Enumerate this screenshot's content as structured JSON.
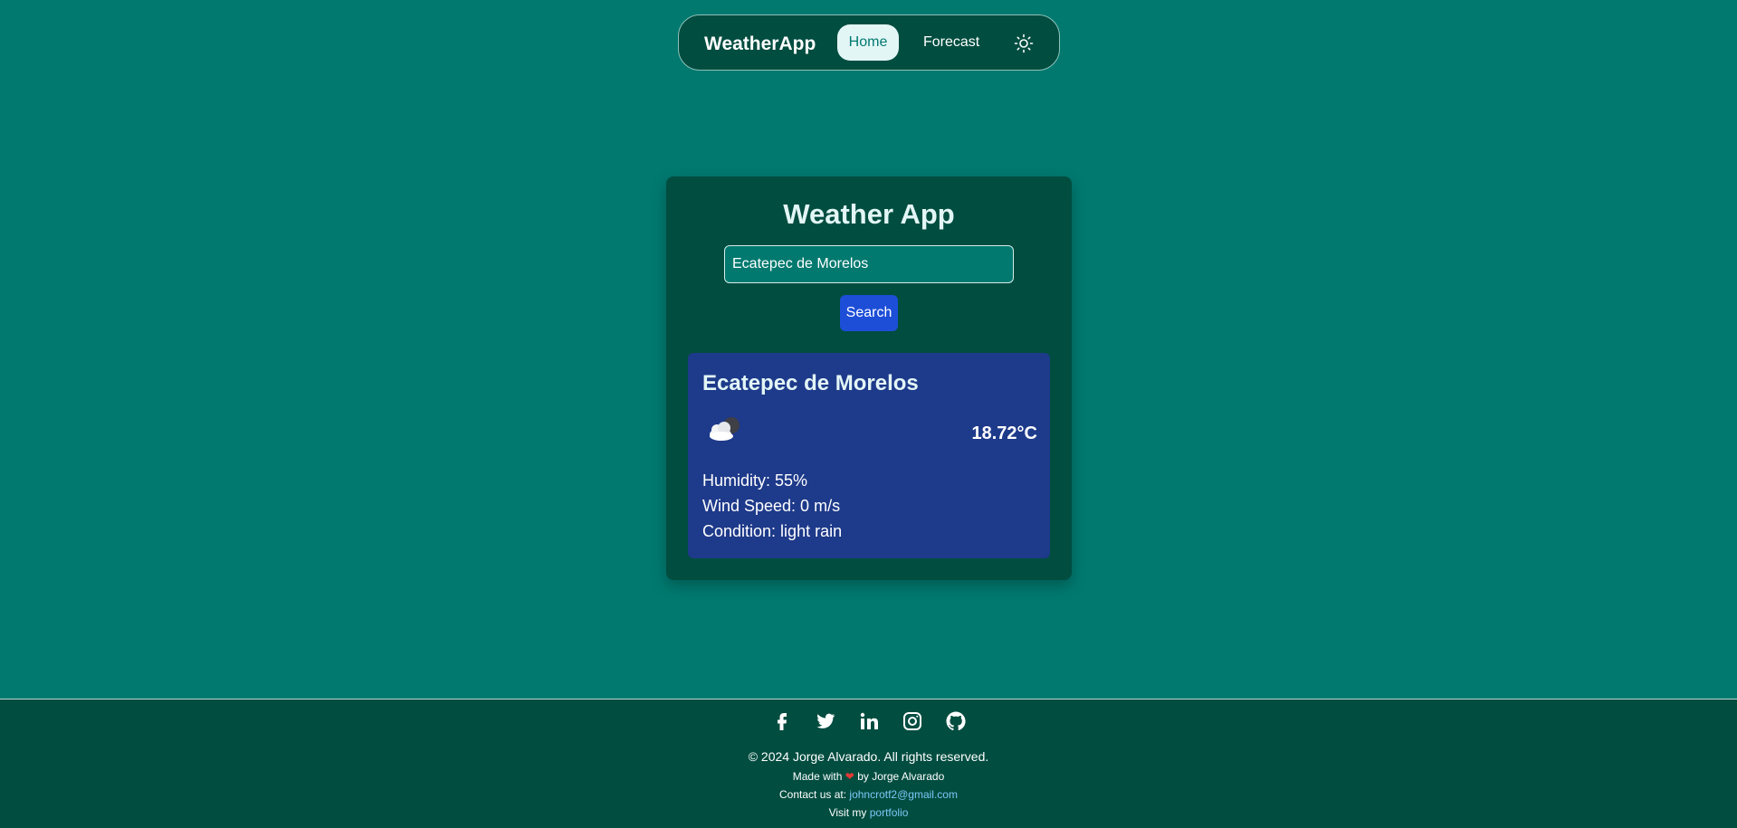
{
  "nav": {
    "brand": "WeatherApp",
    "home_label": "Home",
    "forecast_label": "Forecast",
    "theme_icon": "sun-icon"
  },
  "main": {
    "title": "Weather App",
    "search_value": "Ecatepec de Morelos",
    "search_button": "Search",
    "result": {
      "city": "Ecatepec de Morelos",
      "weather_icon": "cloud-night-icon",
      "temperature": "18.72°C",
      "humidity": "Humidity: 55%",
      "wind_speed": "Wind Speed: 0 m/s",
      "condition": "Condition: light rain"
    }
  },
  "footer": {
    "socials": [
      "facebook-icon",
      "twitter-icon",
      "linkedin-icon",
      "instagram-icon",
      "github-icon"
    ],
    "copyright": "© 2024 Jorge Alvarado. All rights reserved.",
    "made_with_prefix": "Made with",
    "made_with_suffix": "by Jorge Alvarado",
    "contact_prefix": "Contact us at:",
    "contact_email": "johncrotf2@gmail.com",
    "visit_prefix": "Visit my",
    "visit_link": "portfolio"
  },
  "colors": {
    "background": "#01796f",
    "panel": "#014d40",
    "result_card": "#1e3a8a",
    "button": "#1d4ed8",
    "link": "#7dc8f7"
  }
}
